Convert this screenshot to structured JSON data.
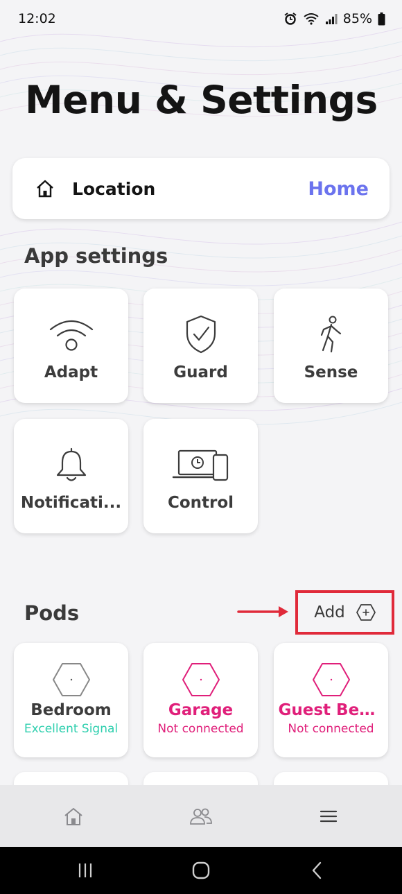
{
  "status_bar": {
    "time": "12:02",
    "battery": "85%"
  },
  "page_title": "Menu & Settings",
  "location": {
    "label": "Location",
    "value": "Home"
  },
  "app_settings": {
    "title": "App settings",
    "tiles": [
      {
        "label": "Adapt",
        "icon": "wifi-icon"
      },
      {
        "label": "Guard",
        "icon": "shield-check-icon"
      },
      {
        "label": "Sense",
        "icon": "walking-person-icon"
      },
      {
        "label": "Notificati...",
        "icon": "bell-icon"
      },
      {
        "label": "Control",
        "icon": "laptop-phone-icon"
      }
    ]
  },
  "pods": {
    "title": "Pods",
    "add_label": "Add",
    "items": [
      {
        "name": "Bedroom",
        "status": "Excellent Signal"
      },
      {
        "name": "Garage",
        "status": "Not connected"
      },
      {
        "name": "Guest Bed...",
        "status": "Not connected"
      }
    ]
  },
  "colors": {
    "accent": "#6b73ee",
    "pink": "#e01f7a",
    "green": "#2ecfae",
    "highlight_red": "#e02a3a"
  },
  "bottom_nav": [
    "home-icon",
    "people-icon",
    "menu-icon"
  ],
  "system_nav": [
    "recents-icon",
    "home-circle-icon",
    "back-icon"
  ]
}
